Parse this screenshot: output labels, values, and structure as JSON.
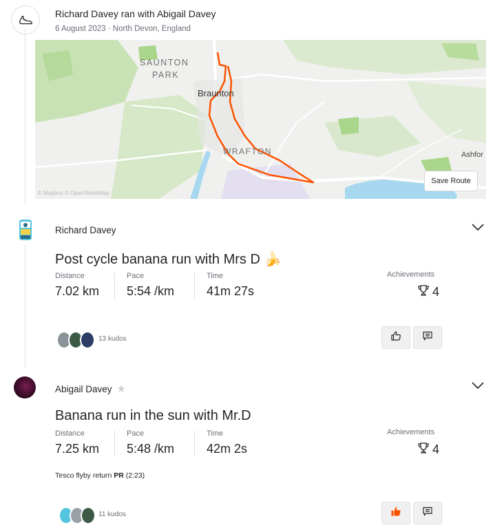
{
  "group_header": {
    "title": "Richard Davey ran with Abigail Davey",
    "date": "6 August 2023",
    "separator": "·",
    "location": "North Devon, England",
    "icon": "running-shoe-icon"
  },
  "map": {
    "labels": [
      "SAUNTON",
      "PARK",
      "Braunton",
      "WRAFTON",
      "Ashfor"
    ],
    "save_route_label": "Save Route",
    "attribution": "© Mapbox © OpenStreetMap",
    "route_color": "#fc5200"
  },
  "activities": [
    {
      "athlete": "Richard Davey",
      "title": "Post cycle banana run with Mrs D",
      "title_emoji": "🍌",
      "stats": [
        {
          "label": "Distance",
          "value": "7.02 km"
        },
        {
          "label": "Pace",
          "value": "5:54 /km"
        },
        {
          "label": "Time",
          "value": "41m 27s"
        }
      ],
      "achievements_label": "Achievements",
      "achievements_count": "4",
      "kudos": "13 kudos"
    },
    {
      "athlete": "Abigail Davey",
      "title": "Banana run in the sun with Mr.D",
      "stats": [
        {
          "label": "Distance",
          "value": "7.25 km"
        },
        {
          "label": "Pace",
          "value": "5:48 /km"
        },
        {
          "label": "Time",
          "value": "42m 2s"
        }
      ],
      "achievements_label": "Achievements",
      "achievements_count": "4",
      "segment_name": "Tesco flyby return",
      "segment_pr": "PR",
      "segment_time": "(2:23)",
      "kudos": "11 kudos"
    }
  ],
  "colors": {
    "accent": "#fc5200",
    "text": "#242428",
    "muted": "#6d6d78"
  }
}
